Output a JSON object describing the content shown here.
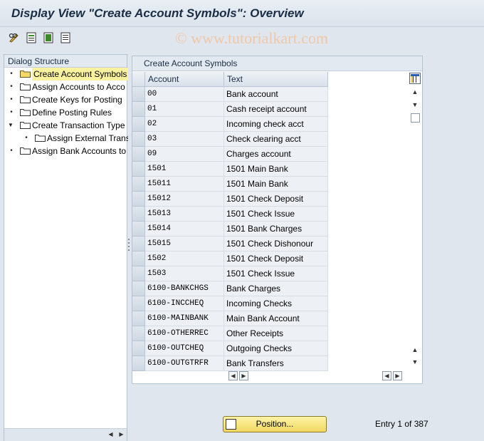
{
  "window": {
    "title": "Display View \"Create Account Symbols\": Overview",
    "watermark": "© www.tutorialkart.com"
  },
  "toolbar": {
    "icons": [
      "edit-glasses-icon",
      "details-icon",
      "select-all-icon",
      "deselect-all-icon"
    ]
  },
  "dialog_structure": {
    "header": "Dialog Structure",
    "items": [
      {
        "label": "Create Account Symbols",
        "selected": true
      },
      {
        "label": "Assign Accounts to Acco"
      },
      {
        "label": "Create Keys for Posting"
      },
      {
        "label": "Define Posting Rules"
      },
      {
        "label": "Create Transaction Type"
      },
      {
        "label": "Assign External Trans"
      },
      {
        "label": "Assign Bank Accounts to"
      }
    ]
  },
  "table": {
    "title": "Create Account Symbols",
    "columns": [
      "Account",
      "Text"
    ],
    "rows": [
      {
        "account": "00",
        "text": "Bank account"
      },
      {
        "account": "01",
        "text": "Cash receipt account"
      },
      {
        "account": "02",
        "text": "Incoming check acct"
      },
      {
        "account": "03",
        "text": "Check clearing acct"
      },
      {
        "account": "09",
        "text": "Charges account"
      },
      {
        "account": "1501",
        "text": "1501 Main Bank"
      },
      {
        "account": "15011",
        "text": "1501 Main Bank"
      },
      {
        "account": "15012",
        "text": "1501 Check Deposit"
      },
      {
        "account": "15013",
        "text": "1501 Check Issue"
      },
      {
        "account": "15014",
        "text": "1501 Bank Charges"
      },
      {
        "account": "15015",
        "text": "1501 Check Dishonour"
      },
      {
        "account": "1502",
        "text": "1501 Check Deposit"
      },
      {
        "account": "1503",
        "text": "1501 Check Issue"
      },
      {
        "account": "6100-BANKCHGS",
        "text": "Bank Charges"
      },
      {
        "account": "6100-INCCHEQ",
        "text": "Incoming Checks"
      },
      {
        "account": "6100-MAINBANK",
        "text": "Main Bank Account"
      },
      {
        "account": "6100-OTHERREC",
        "text": "Other Receipts"
      },
      {
        "account": "6100-OUTCHEQ",
        "text": "Outgoing Checks"
      },
      {
        "account": "6100-OUTGTRFR",
        "text": "Bank Transfers"
      }
    ]
  },
  "footer": {
    "position_button": "Position...",
    "entry_info": "Entry 1 of 387"
  }
}
